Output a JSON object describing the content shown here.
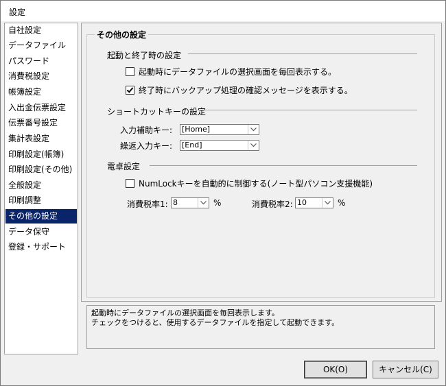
{
  "window": {
    "title": "設定"
  },
  "sidebar": {
    "items": [
      {
        "label": "自社設定"
      },
      {
        "label": "データファイル"
      },
      {
        "label": "パスワード"
      },
      {
        "label": "消費税設定"
      },
      {
        "label": "帳簿設定"
      },
      {
        "label": "入出金伝票設定"
      },
      {
        "label": "伝票番号設定"
      },
      {
        "label": "集計表設定"
      },
      {
        "label": "印刷設定(帳簿)"
      },
      {
        "label": "印刷設定(その他)"
      },
      {
        "label": "全般設定"
      },
      {
        "label": "印刷調整"
      },
      {
        "label": "その他の設定",
        "selected": true
      },
      {
        "label": "データ保守"
      },
      {
        "label": "登録・サポート"
      }
    ]
  },
  "main": {
    "group_title": "その他の設定",
    "startup": {
      "section_label": "起動と終了時の設定",
      "opt1_label": "起動時にデータファイルの選択画面を毎回表示する。",
      "opt1_checked": false,
      "opt2_label": "終了時にバックアップ処理の確認メッセージを表示する。",
      "opt2_checked": true
    },
    "shortcut": {
      "section_label": "ショートカットキーの設定",
      "input_assist_label": "入力補助キー:",
      "input_assist_value": "[Home]",
      "repeat_input_label": "繰返入力キー:",
      "repeat_input_value": "[End]"
    },
    "calculator": {
      "section_label": "電卓設定",
      "numlock_label": "NumLockキーを自動的に制御する(ノート型パソコン支援機能)",
      "numlock_checked": false,
      "tax1_label": "消費税率1:",
      "tax1_value": "8",
      "tax1_unit": "%",
      "tax2_label": "消費税率2:",
      "tax2_value": "10",
      "tax2_unit": "%"
    }
  },
  "description": {
    "line1": "起動時にデータファイルの選択画面を毎回表示します。",
    "line2": "チェックをつけると、使用するデータファイルを指定して起動できます。"
  },
  "buttons": {
    "ok": "OK(O)",
    "cancel": "キャンセル(C)"
  }
}
